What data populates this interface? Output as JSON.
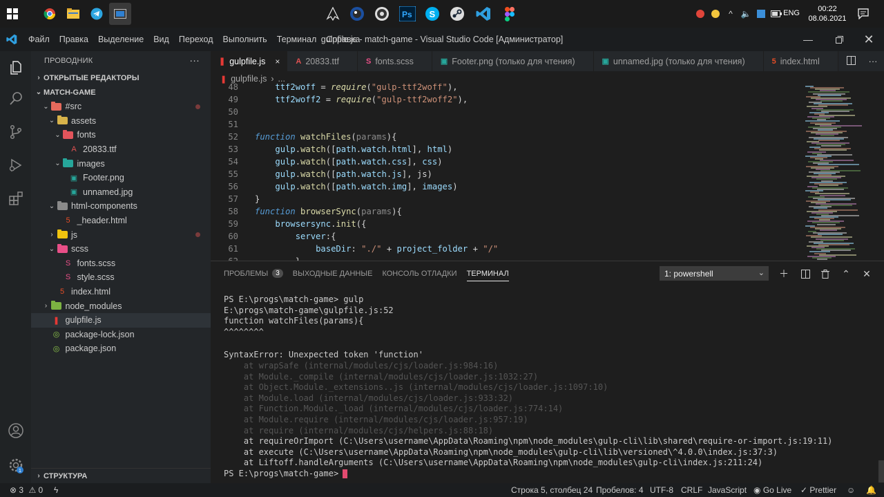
{
  "taskbar": {
    "lang": "ENG",
    "time": "00:22",
    "date": "08.06.2021"
  },
  "window": {
    "title": "gulpfile.js - match-game - Visual Studio Code [Администратор]",
    "menu": [
      "Файл",
      "Правка",
      "Выделение",
      "Вид",
      "Переход",
      "Выполнить",
      "Терминал",
      "Справка"
    ]
  },
  "sidebar": {
    "header": "ПРОВОДНИК",
    "open_editors": "ОТКРЫТЫЕ РЕДАКТОРЫ",
    "project": "MATCH-GAME",
    "outline": "СТРУКТУРА",
    "tree": [
      {
        "label": "#src",
        "type": "folder",
        "color": "#e56a5c",
        "depth": 1,
        "open": true,
        "dot": true
      },
      {
        "label": "assets",
        "type": "folder",
        "color": "#d8b34a",
        "depth": 2,
        "open": true
      },
      {
        "label": "fonts",
        "type": "folder",
        "color": "#e2545b",
        "depth": 3,
        "open": true
      },
      {
        "label": "20833.ttf",
        "type": "file",
        "icon": "A",
        "color": "#e05252",
        "depth": 4
      },
      {
        "label": "images",
        "type": "folder",
        "color": "#26a69a",
        "depth": 3,
        "open": true
      },
      {
        "label": "Footer.png",
        "type": "file",
        "icon": "▣",
        "color": "#26a69a",
        "depth": 4
      },
      {
        "label": "unnamed.jpg",
        "type": "file",
        "icon": "▣",
        "color": "#26a69a",
        "depth": 4
      },
      {
        "label": "html-components",
        "type": "folder",
        "color": "#8a8a8a",
        "depth": 2,
        "open": true
      },
      {
        "label": "_header.html",
        "type": "file",
        "icon": "5",
        "color": "#e44d26",
        "depth": 3
      },
      {
        "label": "js",
        "type": "folder",
        "color": "#f1c40f",
        "depth": 2,
        "open": false,
        "dot": true
      },
      {
        "label": "scss",
        "type": "folder",
        "color": "#e84f87",
        "depth": 2,
        "open": true
      },
      {
        "label": "fonts.scss",
        "type": "file",
        "icon": "S",
        "color": "#e84f87",
        "depth": 3
      },
      {
        "label": "style.scss",
        "type": "file",
        "icon": "S",
        "color": "#e84f87",
        "depth": 3
      },
      {
        "label": "index.html",
        "type": "file",
        "icon": "5",
        "color": "#e44d26",
        "depth": 2
      },
      {
        "label": "node_modules",
        "type": "folder",
        "color": "#7cb342",
        "depth": 1,
        "open": false
      },
      {
        "label": "gulpfile.js",
        "type": "file",
        "icon": "❚",
        "color": "#e53935",
        "depth": 1,
        "active": true
      },
      {
        "label": "package-lock.json",
        "type": "file",
        "icon": "◎",
        "color": "#8bc34a",
        "depth": 1
      },
      {
        "label": "package.json",
        "type": "file",
        "icon": "◎",
        "color": "#8bc34a",
        "depth": 1
      }
    ]
  },
  "tabs": [
    {
      "label": "gulpfile.js",
      "icon": "❚",
      "color": "#e53935",
      "active": true,
      "close": "×"
    },
    {
      "label": "20833.ttf",
      "icon": "A",
      "color": "#e05252"
    },
    {
      "label": "fonts.scss",
      "icon": "S",
      "color": "#e84f87"
    },
    {
      "label": "Footer.png (только для чтения)",
      "icon": "▣",
      "color": "#26a69a"
    },
    {
      "label": "unnamed.jpg (только для чтения)",
      "icon": "▣",
      "color": "#26a69a"
    },
    {
      "label": "index.html",
      "icon": "5",
      "color": "#e44d26"
    }
  ],
  "breadcrumb": {
    "file": "gulpfile.js",
    "sep": "›",
    "more": "..."
  },
  "editor": {
    "lines": [
      {
        "n": "48",
        "code": "    ttf2woff = require(\"gulp-ttf2woff\"),"
      },
      {
        "n": "49",
        "code": "    ttf2woff2 = require(\"gulp-ttf2woff2\"),"
      },
      {
        "n": "50",
        "code": ""
      },
      {
        "n": "51",
        "code": ""
      },
      {
        "n": "52",
        "code": "function watchFiles(params){"
      },
      {
        "n": "53",
        "code": "    gulp.watch([path.watch.html], html)"
      },
      {
        "n": "54",
        "code": "    gulp.watch([path.watch.css], css)"
      },
      {
        "n": "55",
        "code": "    gulp.watch([path.watch.js], js)"
      },
      {
        "n": "56",
        "code": "    gulp.watch([path.watch.img], images)"
      },
      {
        "n": "57",
        "code": "}"
      },
      {
        "n": "58",
        "code": "function browserSync(params){"
      },
      {
        "n": "59",
        "code": "    browsersync.init({"
      },
      {
        "n": "60",
        "code": "        server:{"
      },
      {
        "n": "61",
        "code": "            baseDir: \"./\" + project_folder + \"/\""
      },
      {
        "n": "62",
        "code": "        },"
      }
    ]
  },
  "panel": {
    "tabs": [
      "ПРОБЛЕМЫ",
      "ВЫХОДНЫЕ ДАННЫЕ",
      "КОНСОЛЬ ОТЛАДКИ",
      "ТЕРМИНАЛ"
    ],
    "problems_count": "3",
    "terminal_select": "1: powershell",
    "terminal_lines": [
      {
        "t": "PS E:\\progs\\match-game> gulp",
        "c": ""
      },
      {
        "t": "E:\\progs\\match-game\\gulpfile.js:52",
        "c": ""
      },
      {
        "t": "function watchFiles(params){",
        "c": ""
      },
      {
        "t": "^^^^^^^^",
        "c": ""
      },
      {
        "t": "",
        "c": "gap"
      },
      {
        "t": "SyntaxError: Unexpected token 'function'",
        "c": ""
      },
      {
        "t": "    at wrapSafe (internal/modules/cjs/loader.js:984:16)",
        "c": "dim"
      },
      {
        "t": "    at Module._compile (internal/modules/cjs/loader.js:1032:27)",
        "c": "dim"
      },
      {
        "t": "    at Object.Module._extensions..js (internal/modules/cjs/loader.js:1097:10)",
        "c": "dim"
      },
      {
        "t": "    at Module.load (internal/modules/cjs/loader.js:933:32)",
        "c": "dim"
      },
      {
        "t": "    at Function.Module._load (internal/modules/cjs/loader.js:774:14)",
        "c": "dim"
      },
      {
        "t": "    at Module.require (internal/modules/cjs/loader.js:957:19)",
        "c": "dim"
      },
      {
        "t": "    at require (internal/modules/cjs/helpers.js:88:18)",
        "c": "dim"
      },
      {
        "t": "    at requireOrImport (C:\\Users\\username\\AppData\\Roaming\\npm\\node_modules\\gulp-cli\\lib\\shared\\require-or-import.js:19:11)",
        "c": ""
      },
      {
        "t": "    at execute (C:\\Users\\username\\AppData\\Roaming\\npm\\node_modules\\gulp-cli\\lib\\versioned\\^4.0.0\\index.js:37:3)",
        "c": ""
      },
      {
        "t": "    at Liftoff.handleArguments (C:\\Users\\username\\AppData\\Roaming\\npm\\node_modules\\gulp-cli\\index.js:211:24)",
        "c": ""
      }
    ],
    "prompt": "PS E:\\progs\\match-game>"
  },
  "statusbar": {
    "errors": "3",
    "warnings": "0",
    "position": "Строка 5, столбец 24",
    "spaces": "Пробелов: 4",
    "encoding": "UTF-8",
    "eol": "CRLF",
    "language": "JavaScript",
    "golive": "Go Live",
    "prettier": "Prettier"
  },
  "colors": {
    "accent_vscode": "#2f80d1",
    "error": "#e53935"
  }
}
